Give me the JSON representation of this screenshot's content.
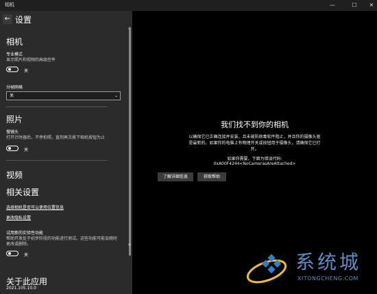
{
  "window": {
    "title": "相机",
    "minimize": "—",
    "maximize": "☐",
    "close": "✕"
  },
  "settings": {
    "back": "←",
    "title": "设置",
    "camera_heading": "相机",
    "pro_mode_label": "专业模式",
    "pro_mode_desc": "显示照片和视频的高级控件",
    "pro_mode_state": "关",
    "grid_label": "分帧网格",
    "grid_value": "关",
    "photo_heading": "照片",
    "timelapse_label": "慢镜头",
    "timelapse_desc": "打开计时器后，不停拍照，直到再次按下相机按钮为止",
    "timelapse_state": "关",
    "video_heading": "视频",
    "related_heading": "相关设置",
    "link_location": "选择相机是否可以使用位置信息",
    "link_privacy": "更改隐私设置",
    "experimental_label": "试用新的实验性功能",
    "experimental_desc1": "帮助开发处于初步阶段的功能进行测试。这些功能可能会随时",
    "experimental_desc2": "更改或删除。",
    "experimental_state": "关",
    "about_heading": "关于此应用",
    "version": "2021.105.10.0"
  },
  "error": {
    "title": "我们找不到你的相机",
    "line1": "以确保它已正确连接并安装，且未被防病毒软件阻止，并且你的摄像头驱",
    "line2": "是最新的。如果你的电脑上有物理开关或按钮用于摄像头，请确保它已打",
    "line3": "开。",
    "code_intro": "如果你需要，下面为错误代码:",
    "code": "0xA00F4244<NoCamerasAreAttached>",
    "details_button": "了解详细信息",
    "help_button": "获取帮助"
  },
  "watermark": {
    "text": "系统城",
    "url": "XITONGCHENG.COM"
  }
}
